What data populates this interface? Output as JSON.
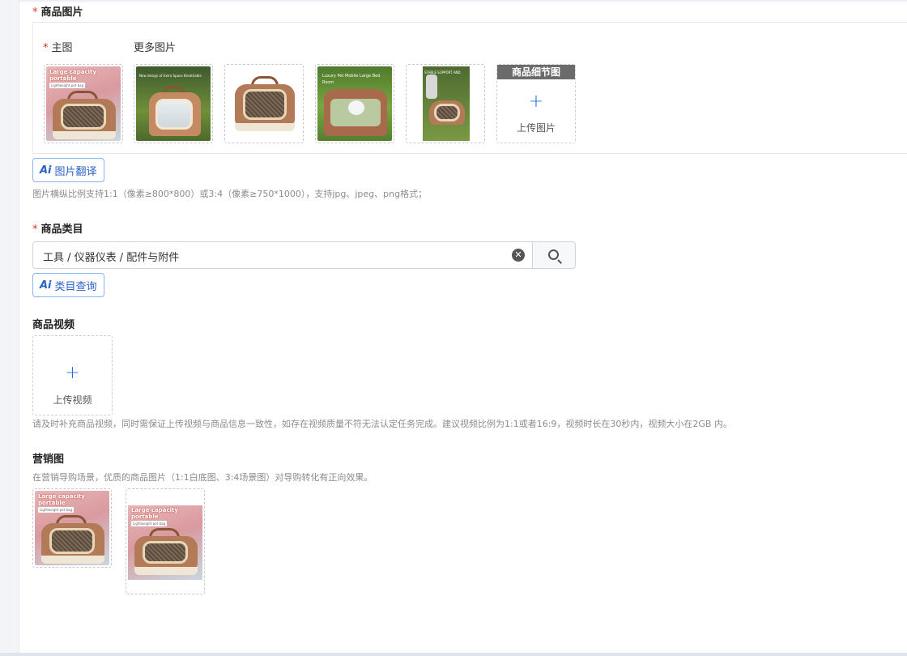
{
  "product_images": {
    "section_title": "商品图片",
    "main_label": "主图",
    "more_label": "更多图片",
    "thumbnails": [
      {
        "name": "main-image-thumbnail",
        "caption": "Large capacity portable",
        "tag": "Lightweight pet bag"
      },
      {
        "name": "more-image-1",
        "caption": "New design of Extra Space Breathable"
      },
      {
        "name": "more-image-2",
        "caption": ""
      },
      {
        "name": "more-image-3",
        "caption": "Luxury Pet Mobile Large Bed Room"
      },
      {
        "name": "more-image-4",
        "caption": "STABLE SUPPORT AND"
      }
    ],
    "detail_upload": {
      "header": "商品细节图",
      "plus": "+",
      "label": "上传图片"
    },
    "translate_button": {
      "ai": "Ai",
      "label": "图片翻译"
    },
    "hint": "图片横纵比例支持1:1（像素≥800*800）或3:4（像素≥750*1000），支持jpg、jpeg、png格式；"
  },
  "category": {
    "section_title": "商品类目",
    "value": "工具 / 仪器仪表 / 配件与附件",
    "query_button": {
      "ai": "Ai",
      "label": "类目查询"
    }
  },
  "video": {
    "section_title": "商品视频",
    "upload": {
      "plus": "+",
      "label": "上传视频"
    },
    "hint": "请及时补充商品视频，同时需保证上传视频与商品信息一致性，如存在视频质量不符无法认定任务完成。建议视频比例为1:1或者16:9，视频时长在30秒内，视频大小在2GB 内。"
  },
  "marketing": {
    "section_title": "营销图",
    "hint": "在营销导购场景，优质的商品图片（1:1白底图、3:4场景图）对导购转化有正向效果。",
    "images": [
      {
        "name": "marketing-image-square",
        "caption": "Large capacity portable",
        "tag": "Lightweight pet bag"
      },
      {
        "name": "marketing-image-portrait",
        "caption": "Large capacity portable",
        "tag": "Lightweight pet bag"
      }
    ]
  },
  "colors": {
    "accent": "#1e6fd9",
    "required": "#e0301e"
  }
}
